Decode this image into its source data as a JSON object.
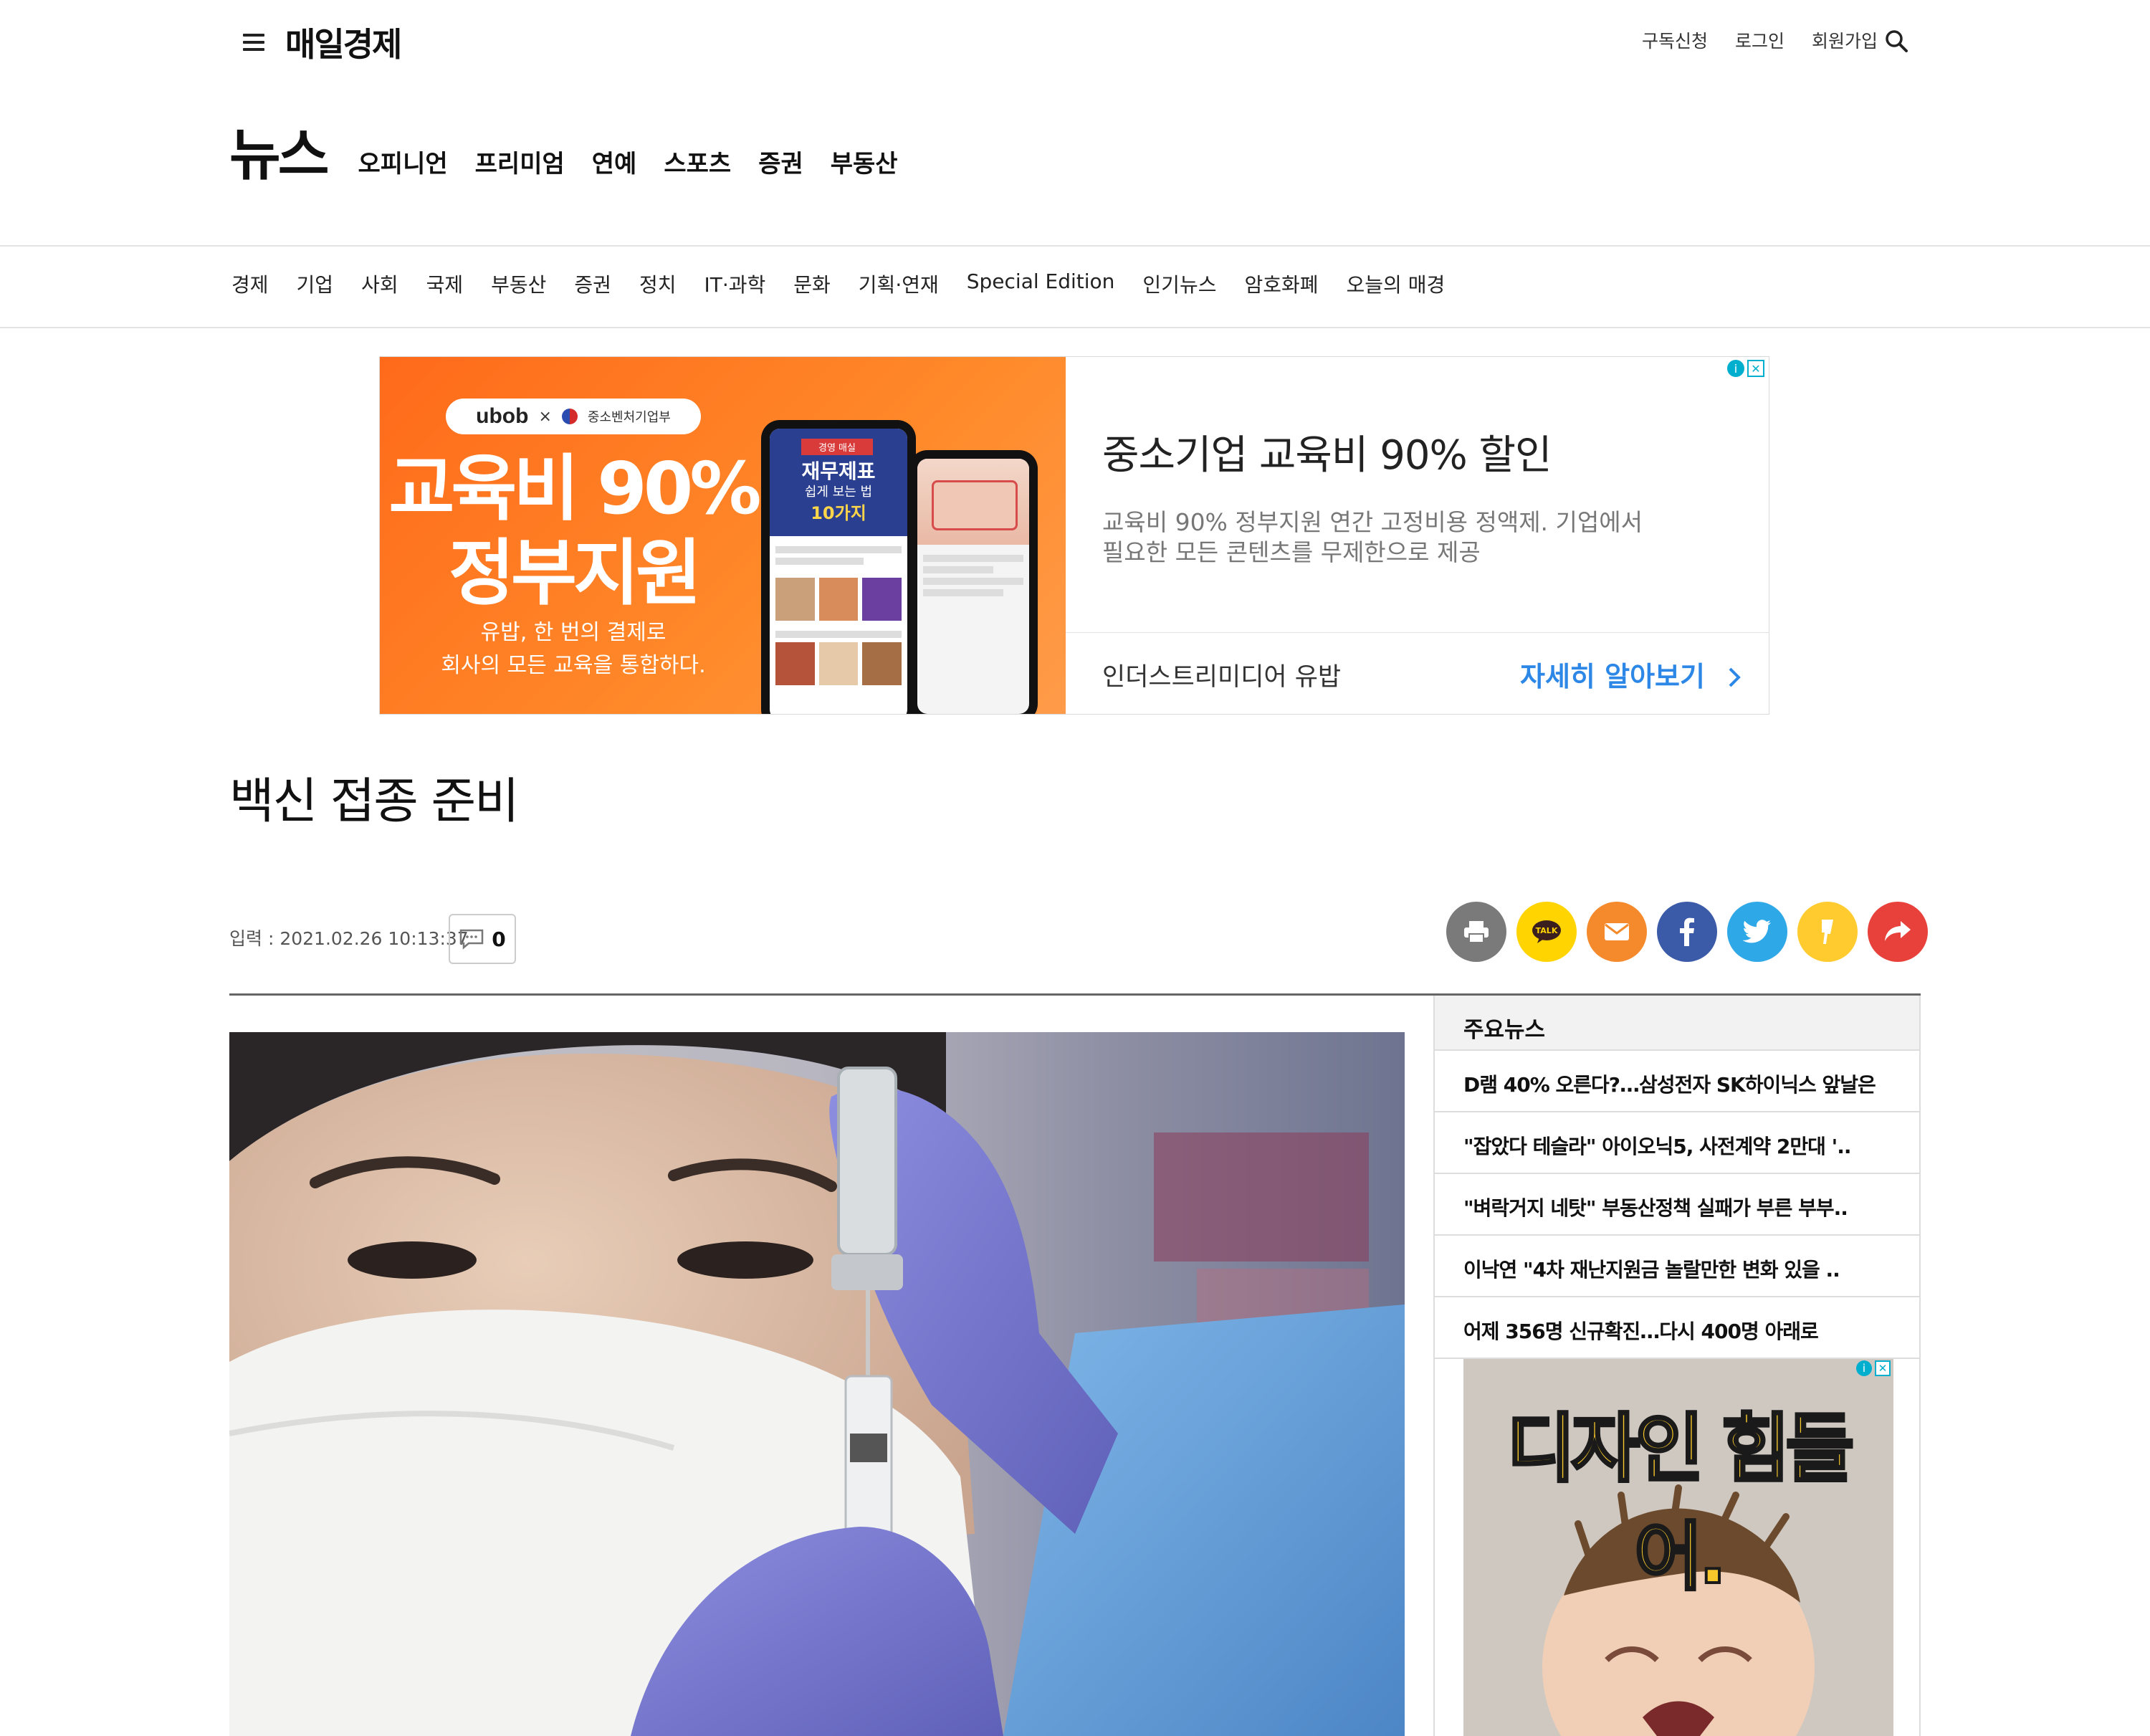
{
  "header": {
    "logo": "매일경제",
    "links": [
      "구독신청",
      "로그인",
      "회원가입"
    ]
  },
  "section_nav": {
    "brand": "뉴스",
    "tabs": [
      "오피니언",
      "프리미엄",
      "연예",
      "스포츠",
      "증권",
      "부동산"
    ]
  },
  "sub_nav": [
    "경제",
    "기업",
    "사회",
    "국제",
    "부동산",
    "증권",
    "정치",
    "IT·과학",
    "문화",
    "기획·연재",
    "Special Edition",
    "인기뉴스",
    "암호화폐",
    "오늘의 매경"
  ],
  "ad": {
    "pill_brand": "ubob",
    "pill_x": "×",
    "pill_partner": "중소벤처기업부",
    "headline_line1": "교육비 90%",
    "headline_line2": "정부지원",
    "slogan_line1": "유밥, 한 번의 결제로",
    "slogan_line2": "회사의 모든 교육을 통합하다.",
    "phone_title1": "재무제표",
    "phone_title2": "쉽게 보는 법",
    "phone_title3": "10가지",
    "phone_tag": "경영 매실",
    "title": "중소기업 교육비 90% 할인",
    "desc_line1": "교육비 90% 정부지원 연간 고정비용 정액제. 기업에서",
    "desc_line2": "필요한 모든 콘텐츠를 무제한으로 제공",
    "advertiser": "인더스트리미디어 유밥",
    "cta": "자세히 알아보기"
  },
  "article": {
    "headline": "백신 접종 준비",
    "input_time": "입력 : 2021.02.26 10:13:37",
    "comment_count": "0"
  },
  "share_buttons": [
    {
      "name": "print",
      "color": "#7a7a7a"
    },
    {
      "name": "kakaotalk",
      "color": "#ffd400"
    },
    {
      "name": "email",
      "color": "#f58a2c"
    },
    {
      "name": "facebook",
      "color": "#3b5ba8"
    },
    {
      "name": "twitter",
      "color": "#2fa8e8"
    },
    {
      "name": "kakaostory",
      "color": "#ffcb2f"
    },
    {
      "name": "share",
      "color": "#e8413b"
    }
  ],
  "sidebar": {
    "title": "주요뉴스",
    "items": [
      "D램 40% 오른다?…삼성전자 SK하이닉스 앞날은",
      "\"잡았다 테슬라\" 아이오닉5, 사전계약 2만대 '..",
      "\"벼락거지 네탓\" 부동산정책 실패가 부른 부부..",
      "이낙연 \"4차 재난지원금 놀랄만한 변화 있을 ..",
      "어제 356명 신규확진…다시 400명 아래로"
    ],
    "ad_text": "디자인 힘들어."
  }
}
